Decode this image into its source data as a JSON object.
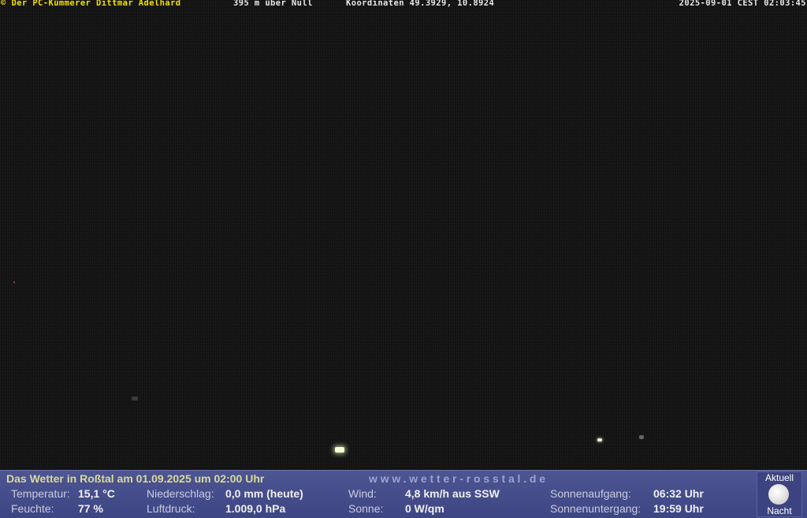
{
  "overlay": {
    "copyright": "© Der PC-Kümmerer Dittmar Adelhard",
    "altitude": "395 m über Null",
    "coordinates": "Koordinaten 49.3929, 10.8924",
    "timestamp": "2025-09-01 CEST 02:03:45"
  },
  "weather": {
    "title": "Das Wetter in Roßtal am 01.09.2025 um 02:00 Uhr",
    "url": "www.wetter-rosstal.de",
    "temperature_label": "Temperatur:",
    "temperature_value": "15,1 °C",
    "humidity_label": "Feuchte:",
    "humidity_value": "77 %",
    "precip_label": "Niederschlag:",
    "precip_value": "0,0 mm (heute)",
    "pressure_label": "Luftdruck:",
    "pressure_value": "1.009,0 hPa",
    "wind_label": "Wind:",
    "wind_value": "4,8 km/h aus SSW",
    "sun_label": "Sonne:",
    "sun_value": "0 W/qm",
    "sunrise_label": "Sonnenaufgang:",
    "sunrise_value": "06:32 Uhr",
    "sunset_label": "Sonnenuntergang:",
    "sunset_value": "19:59 Uhr",
    "moon_top": "Aktuell",
    "moon_bottom": "Nacht"
  }
}
